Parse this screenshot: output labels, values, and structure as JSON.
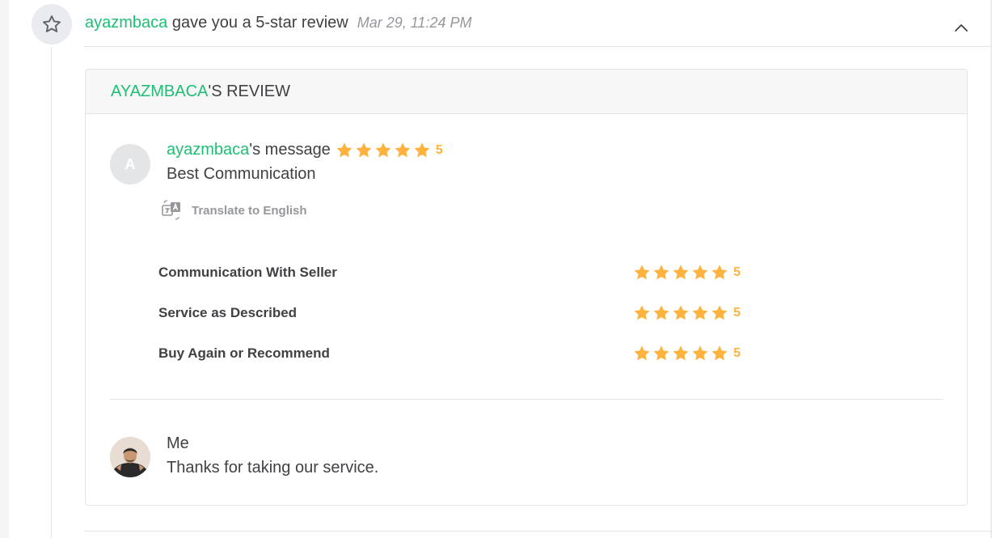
{
  "event": {
    "username": "ayazmbaca",
    "action_text": "gave you a 5-star review",
    "timestamp": "Mar 29, 11:24 PM",
    "icon": "star-outline-icon",
    "collapse_icon": "chevron-up-icon"
  },
  "review": {
    "header_username": "AYAZMBACA",
    "header_suffix": "'S REVIEW",
    "avatar_letter": "A",
    "message_username": "ayazmbaca",
    "message_label": "'s message",
    "overall_rating": "5",
    "message_text": "Best Communication",
    "translate_label": "Translate to English",
    "translate_icon": "translate-icon",
    "ratings": [
      {
        "label": "Communication With Seller",
        "value": "5"
      },
      {
        "label": "Service as Described",
        "value": "5"
      },
      {
        "label": "Buy Again or Recommend",
        "value": "5"
      }
    ]
  },
  "reply": {
    "name": "Me",
    "text": "Thanks for taking our service."
  },
  "colors": {
    "accent_green": "#1dbf73",
    "star_orange": "#ffb33e",
    "text_dark": "#404145",
    "text_muted": "#95979d"
  }
}
